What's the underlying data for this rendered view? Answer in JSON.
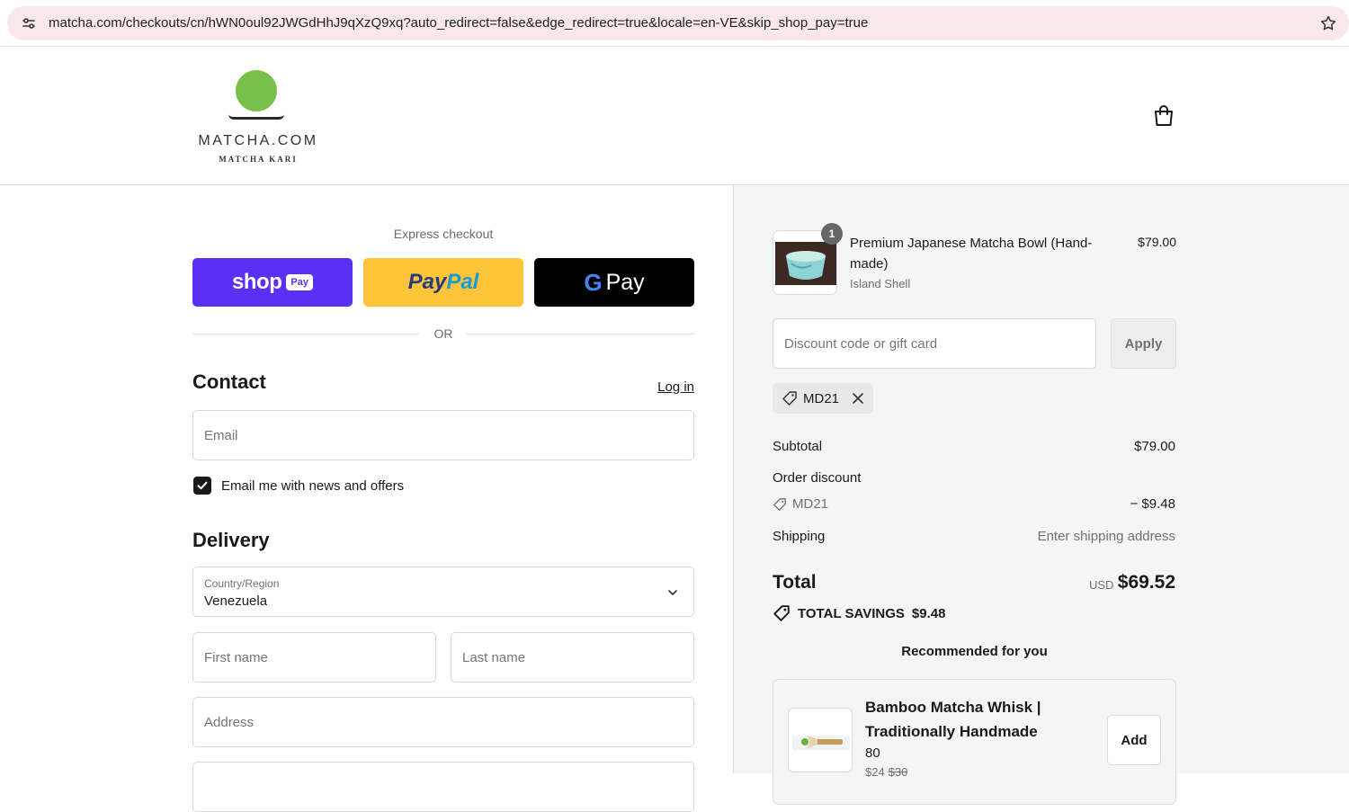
{
  "browser": {
    "url": "matcha.com/checkouts/cn/hWN0oul92JWGdHhJ9qXzQ9xq?auto_redirect=false&edge_redirect=true&locale=en-VE&skip_shop_pay=true"
  },
  "header": {
    "logo_main": "MATCHA.COM",
    "logo_sub": "MATCHA KARI"
  },
  "checkout": {
    "express_label": "Express checkout",
    "shop_word": "shop",
    "shop_badge": "Pay",
    "paypal_part1": "Pay",
    "paypal_part2": "Pal",
    "gpay_g": "G",
    "gpay_word": "Pay",
    "or_text": "OR",
    "contact_title": "Contact",
    "login_link": "Log in",
    "email_placeholder": "Email",
    "news_checkbox_label": "Email me with news and offers",
    "news_checked": true,
    "delivery_title": "Delivery",
    "country_label": "Country/Region",
    "country_value": "Venezuela",
    "first_name_placeholder": "First name",
    "last_name_placeholder": "Last name",
    "address_placeholder": "Address"
  },
  "summary": {
    "item": {
      "quantity": "1",
      "name": "Premium Japanese Matcha Bowl (Hand-made)",
      "variant": "Island Shell",
      "price": "$79.00"
    },
    "discount_placeholder": "Discount code or gift card",
    "apply_label": "Apply",
    "applied_code": "MD21",
    "subtotal_label": "Subtotal",
    "subtotal_value": "$79.00",
    "order_discount_label": "Order discount",
    "discount_code": "MD21",
    "discount_value": "− $9.48",
    "shipping_label": "Shipping",
    "shipping_value": "Enter shipping address",
    "total_label": "Total",
    "total_currency": "USD",
    "total_value": "$69.52",
    "savings_label": "TOTAL SAVINGS",
    "savings_value": "$9.48",
    "recommended_title": "Recommended for you",
    "recommended": {
      "name": "Bamboo Matcha Whisk | Traditionally Handmade",
      "subtitle": "80",
      "price": "$24",
      "old_price": "$30",
      "add_label": "Add"
    }
  },
  "colors": {
    "shop_pay": "#5a31f4",
    "paypal": "#ffc439",
    "gpay": "#000000",
    "logo_green": "#78c04a"
  }
}
